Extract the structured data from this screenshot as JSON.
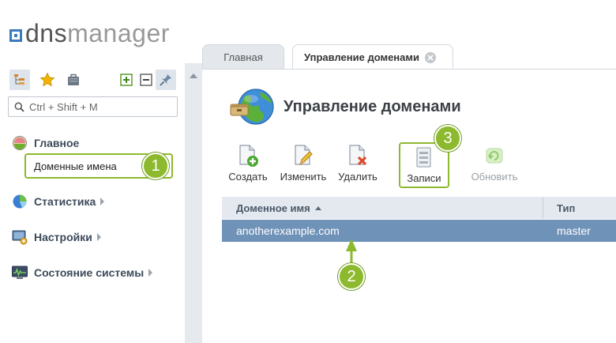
{
  "logo": {
    "part1": "dns",
    "part2": "manager"
  },
  "sidebar": {
    "search_placeholder": "Ctrl + Shift + M",
    "items": [
      {
        "label": "Главное",
        "icon": "home-icon"
      },
      {
        "label": "Статистика",
        "icon": "pie-chart-icon"
      },
      {
        "label": "Настройки",
        "icon": "settings-icon"
      },
      {
        "label": "Состояние системы",
        "icon": "monitor-icon"
      }
    ],
    "sub_item": "Доменные имена"
  },
  "tabs": [
    {
      "label": "Главная"
    },
    {
      "label": "Управление доменами"
    }
  ],
  "page": {
    "title": "Управление доменами"
  },
  "toolbar": {
    "create": "Создать",
    "edit": "Изменить",
    "delete": "Удалить",
    "records": "Записи",
    "refresh": "Обновить"
  },
  "grid": {
    "columns": [
      "Доменное имя",
      "Тип"
    ],
    "rows": [
      {
        "domain": "anotherexample.com",
        "type": "master"
      }
    ]
  },
  "badges": {
    "b1": "1",
    "b2": "2",
    "b3": "3"
  },
  "colors": {
    "accent": "#8db92e",
    "selected_row": "#6f92b8",
    "header": "#e4e9ef"
  }
}
